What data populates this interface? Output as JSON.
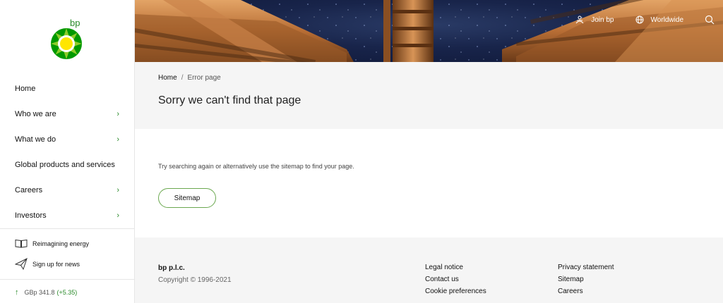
{
  "brand": {
    "logo_text": "bp",
    "accent": "#2a8a2a",
    "logo_green": "#009900",
    "logo_yellow": "#ffe600"
  },
  "sidebar": {
    "items": [
      {
        "label": "Home",
        "chevron": false
      },
      {
        "label": "Who we are",
        "chevron": true
      },
      {
        "label": "What we do",
        "chevron": true
      },
      {
        "label": "Global products and services",
        "chevron": false
      },
      {
        "label": "Careers",
        "chevron": true
      },
      {
        "label": "Investors",
        "chevron": true
      }
    ],
    "chevron_glyph": "›",
    "reimagining": "Reimagining energy",
    "signup": "Sign up for news",
    "share": {
      "label": "GBp 341.8",
      "change": "(+5.35)"
    }
  },
  "topnav": {
    "join": "Join bp",
    "worldwide": "Worldwide"
  },
  "breadcrumb": {
    "home": "Home",
    "sep": "/",
    "current": "Error page"
  },
  "page": {
    "title": "Sorry we can't find that page",
    "help_text": "Try searching again or alternatively use the sitemap to find your page.",
    "sitemap_button": "Sitemap"
  },
  "footer": {
    "company": "bp p.l.c.",
    "copyright": "Copyright © 1996-2021",
    "col1": [
      "Legal notice",
      "Contact us",
      "Cookie preferences"
    ],
    "col2": [
      "Privacy statement",
      "Sitemap",
      "Careers"
    ]
  },
  "icons": [
    "bp-helios-logo",
    "book-icon",
    "paper-plane-icon",
    "arrow-up-icon",
    "chevron-right-icon",
    "people-icon",
    "globe-icon",
    "search-icon"
  ]
}
